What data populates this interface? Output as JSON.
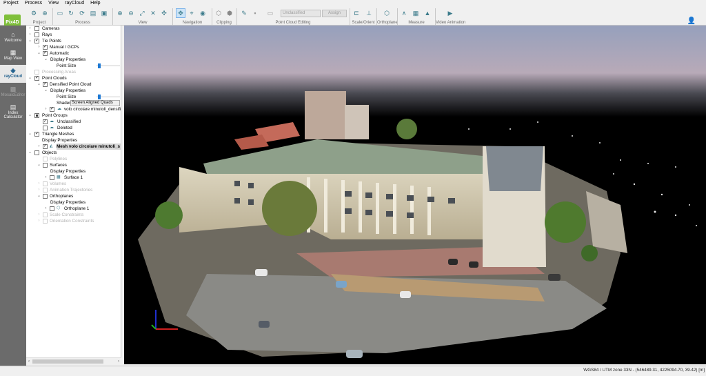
{
  "menu": [
    "Project",
    "Process",
    "View",
    "rayCloud",
    "Help"
  ],
  "logo_text": "Pix4D",
  "toolbar": {
    "groups": {
      "project": "Project",
      "process": "Process",
      "view": "View",
      "navigation": "Navigation",
      "clipping": "Clipping",
      "point_cloud_editing": "Point Cloud Editing",
      "scale_orient": "Scale/Orient",
      "orthoplane": "Orthoplane",
      "measure": "Measure",
      "video_animation": "Video Animation"
    },
    "class_combo": "Unclassified",
    "assign_label": "Assign"
  },
  "sidebar": [
    {
      "label": "Welcome",
      "icon": "home-icon"
    },
    {
      "label": "Map View",
      "icon": "map-icon"
    },
    {
      "label": "rayCloud",
      "icon": "raycloud-icon"
    },
    {
      "label": "MosaicEditor",
      "icon": "mosaic-icon"
    },
    {
      "label": "Index Calculator",
      "icon": "index-calculator-icon"
    }
  ],
  "layers": {
    "cameras": "Cameras",
    "rays": "Rays",
    "tie_points": "Tie Points",
    "manual_gcps": "Manual / GCPs",
    "automatic": "Automatic",
    "display_properties": "Display Properties",
    "point_size": "Point Size",
    "processing_areas": "Processing Areas",
    "point_clouds": "Point Clouds",
    "densified_point_cloud": "Densified Point Cloud",
    "shader": "Shader",
    "shader_value": "Screen Aligned Quads",
    "dense_cloud_file": "volo circolare minutoli_densified",
    "point_groups": "Point Groups",
    "unclassified": "Unclassified",
    "deleted": "Deleted",
    "triangle_meshes": "Triangle Meshes",
    "mesh_name": "Mesh volo circolare minutoli_s",
    "objects": "Objects",
    "polylines": "Polylines",
    "surfaces": "Surfaces",
    "surface_1": "Surface 1",
    "volumes": "Volumes",
    "animation_trajectories": "Animation Trajectories",
    "orthoplanes": "Orthoplanes",
    "orthoplane_1": "Orthoplane 1",
    "scale_constraints": "Scale Constraints",
    "orientation_constraints": "Orientation Constraints"
  },
  "status": {
    "coordinates": "WGS84 / UTM zone 33N - (546489.31, 4225094.70, 39.42) [m]"
  },
  "colors": {
    "sidebar": "#6b6b6b",
    "active_tab_text": "#1e5e8c",
    "slider": "#1c78d4",
    "sky_top": "#96a0bc",
    "sky_bottom": "#000000"
  }
}
